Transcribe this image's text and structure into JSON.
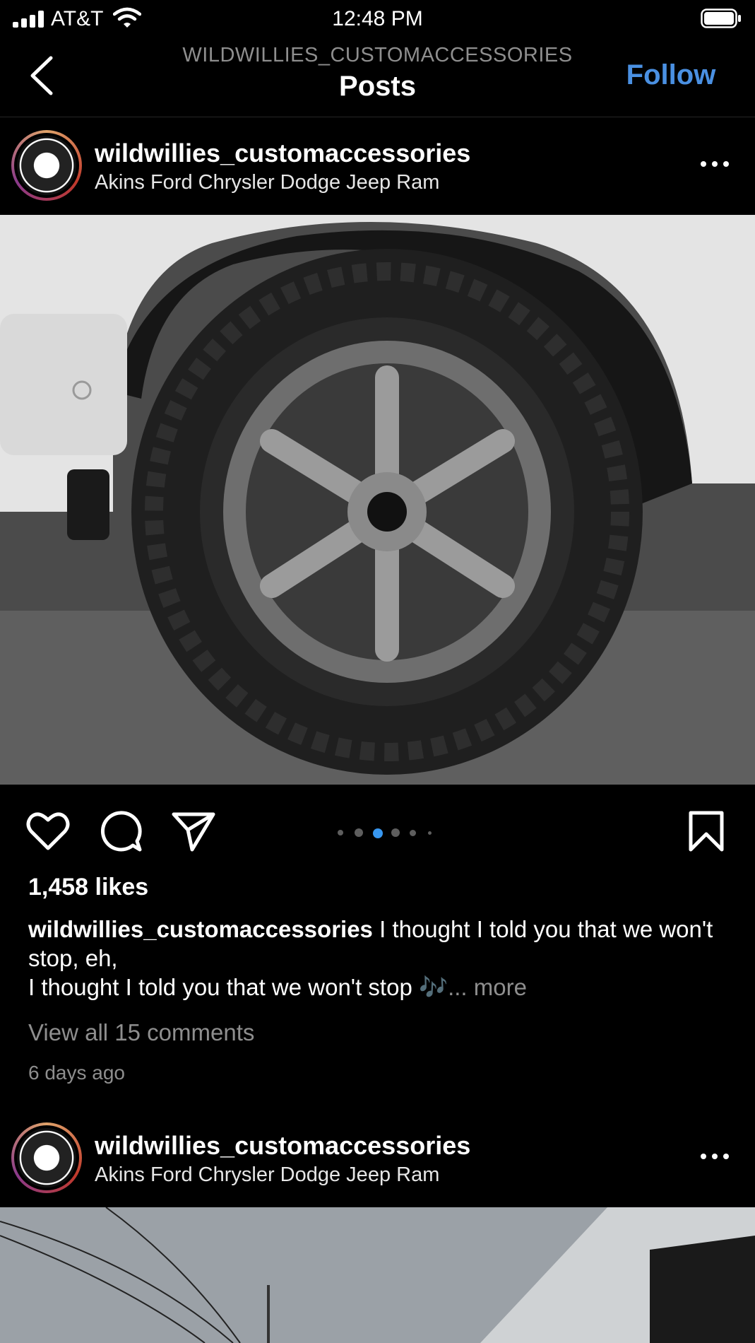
{
  "status_bar": {
    "carrier": "AT&T",
    "time": "12:48 PM"
  },
  "header": {
    "subtitle": "WILDWILLIES_CUSTOMACCESSORIES",
    "title": "Posts",
    "follow_label": "Follow",
    "accent_color": "#4a90e2"
  },
  "posts": [
    {
      "username": "wildwillies_customaccessories",
      "location": "Akins Ford Chrysler Dodge Jeep Ram",
      "likes": "1,458 likes",
      "caption_user": "wildwillies_customaccessories",
      "caption_line1": " I thought I told you that we won't stop, eh,",
      "caption_line2": "I thought I told you that we won't stop 🎶",
      "caption_more": "... more",
      "view_comments": "View all 15 comments",
      "time_ago": "6 days ago",
      "carousel": {
        "count": 6,
        "active_index": 2
      },
      "photo_icon": "truck-wheel-photo"
    },
    {
      "username": "wildwillies_customaccessories",
      "location": "Akins Ford Chrysler Dodge Jeep Ram",
      "photo_icon": "garage-building-photo"
    }
  ],
  "icons": [
    "signal-icon",
    "wifi-icon",
    "battery-icon",
    "back-icon",
    "more-icon",
    "heart-icon",
    "comment-icon",
    "share-icon",
    "bookmark-icon"
  ]
}
